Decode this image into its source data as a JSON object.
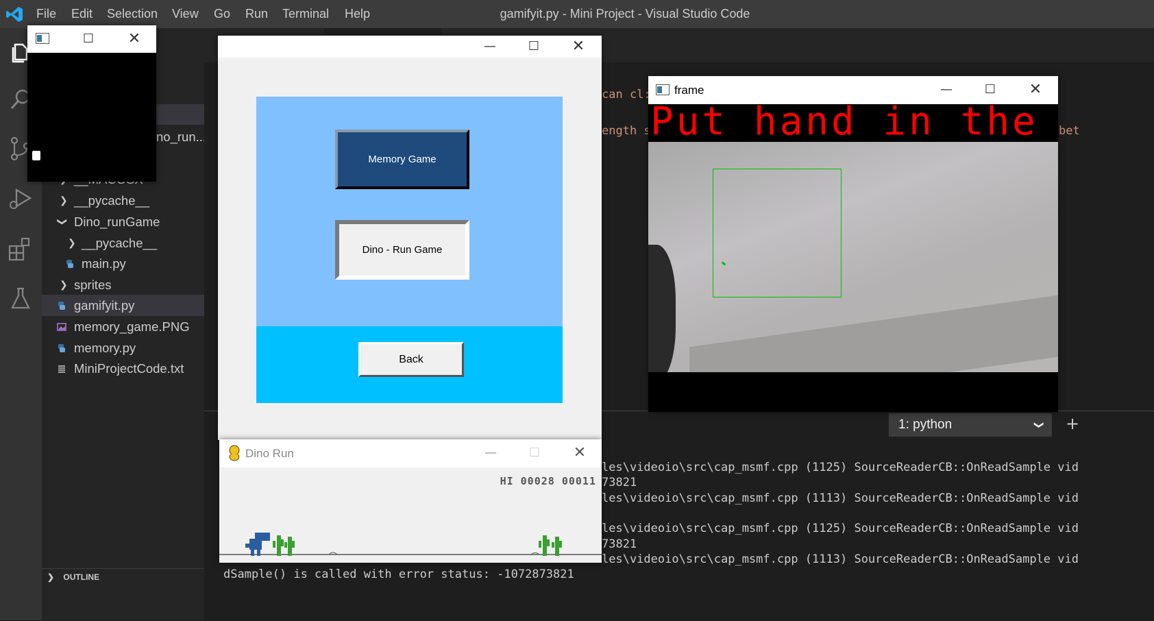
{
  "vscode": {
    "menu": [
      "File",
      "Edit",
      "Selection",
      "View",
      "Go",
      "Run",
      "Terminal",
      "Help"
    ],
    "window_title": "gamifyit.py - Mini Project - Visual Studio Code",
    "explorer": {
      "items": [
        {
          "label": "no_run...",
          "type": "text"
        },
        {
          "label": "__MACOSX",
          "type": "folder"
        },
        {
          "label": "__pycache__",
          "type": "folder"
        },
        {
          "label": "Dino_runGame",
          "type": "folder-open"
        },
        {
          "label": "__pycache__",
          "type": "folder"
        },
        {
          "label": "main.py",
          "type": "python"
        },
        {
          "label": "sprites",
          "type": "folder"
        },
        {
          "label": "gamifyit.py",
          "type": "python"
        },
        {
          "label": "memory_game.PNG",
          "type": "image"
        },
        {
          "label": "memory.py",
          "type": "python"
        },
        {
          "label": "MiniProjectCode.txt",
          "type": "text-file"
        }
      ],
      "outline_label": "OUTLINE"
    },
    "editor_fragments": [
      "can cl:",
      "ength s",
      "bet"
    ],
    "terminal": {
      "selector": "1: python",
      "plus": "+",
      "lines": [
        "les\\videoio\\src\\cap_msmf.cpp (1125) SourceReaderCB::OnReadSample vid",
        "73821",
        "les\\videoio\\src\\cap_msmf.cpp (1113) SourceReaderCB::OnReadSample vid",
        "",
        "les\\videoio\\src\\cap_msmf.cpp (1125) SourceReaderCB::OnReadSample vid",
        "73821",
        "les\\videoio\\src\\cap_msmf.cpp (1113) SourceReaderCB::OnReadSample vid"
      ],
      "bottom_line": "dSample() is called with error status: -1072873821"
    }
  },
  "small_window": {
    "title": ""
  },
  "tk_window": {
    "buttons": {
      "memory": "Memory Game",
      "dino": "Dino - Run Game",
      "back": "Back"
    },
    "colors": {
      "top_panel": "#80c0ff",
      "bottom_panel": "#00c0ff",
      "memory_btn": "#1e4a7c"
    }
  },
  "frame_window": {
    "title": "frame",
    "overlay_text": "Put hand in the box",
    "overlay_color": "#ff0000",
    "box_color": "#00c000"
  },
  "dino_window": {
    "title": "Dino Run",
    "score_text": "HI 00028 00011"
  }
}
